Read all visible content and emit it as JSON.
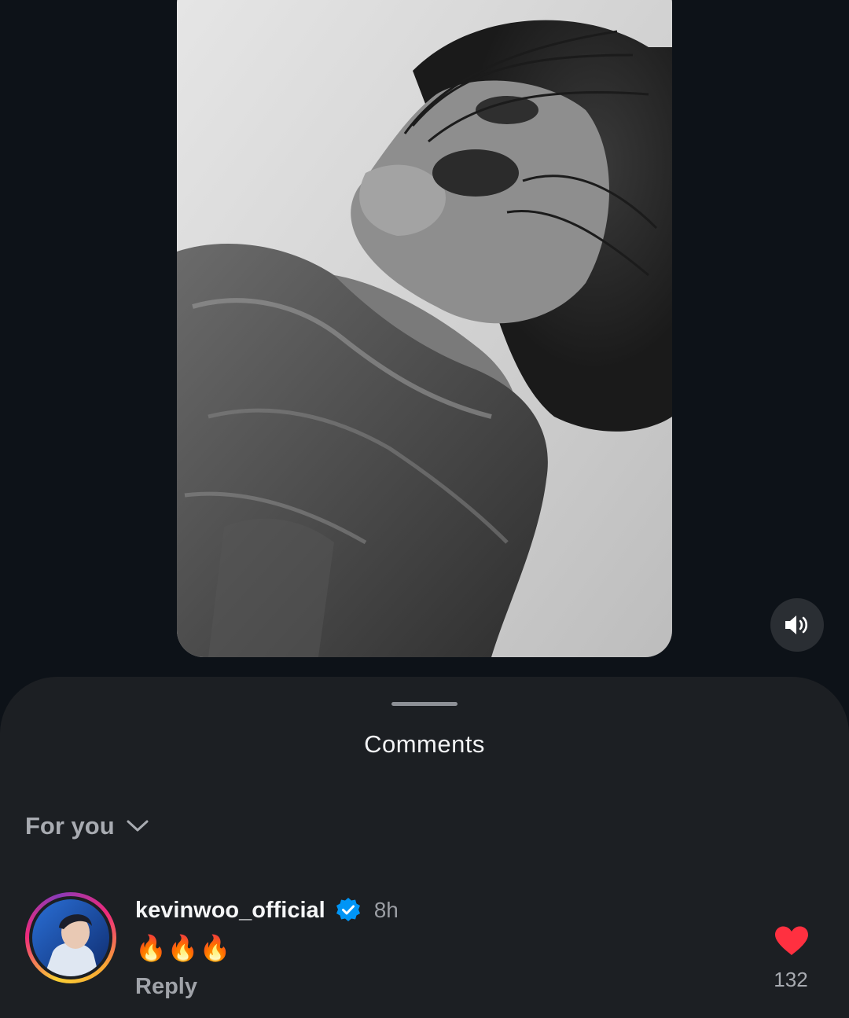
{
  "media": {
    "icon": "speaker-icon"
  },
  "comments_sheet": {
    "title": "Comments",
    "sort": {
      "selected": "For you",
      "icon": "chevron-down-icon"
    },
    "items": [
      {
        "username": "kevinwoo_official",
        "verified": true,
        "time": "8h",
        "text": "🔥🔥🔥",
        "reply_label": "Reply",
        "like_count": "132",
        "liked": true
      }
    ]
  },
  "colors": {
    "background": "#0d1218",
    "sheet": "#1c1f23",
    "like": "#ff3040",
    "verified": "#0095f6"
  }
}
